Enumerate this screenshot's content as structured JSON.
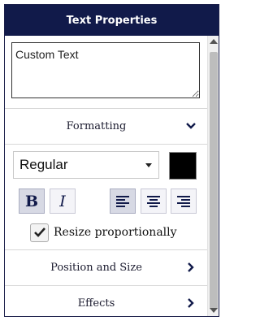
{
  "panel": {
    "title": "Text Properties",
    "text_value": "Custom Text",
    "sections": {
      "formatting": {
        "label": "Formatting",
        "expanded": true,
        "chevron_icon": "chevron-down-icon"
      },
      "position_size": {
        "label": "Position and Size",
        "chevron_icon": "chevron-right-icon"
      },
      "effects": {
        "label": "Effects",
        "chevron_icon": "chevron-right-icon"
      }
    },
    "formatting": {
      "font_style": "Regular",
      "color": "#000000",
      "bold_label": "B",
      "italic_label": "I",
      "bold_active": true,
      "align_left_active": true,
      "align_icons": [
        "align-left-icon",
        "align-center-icon",
        "align-right-icon"
      ],
      "resize_label": "Resize proportionally",
      "resize_checked": true
    }
  },
  "colors": {
    "header_bg": "#111a4a",
    "accent": "#111a4a"
  }
}
